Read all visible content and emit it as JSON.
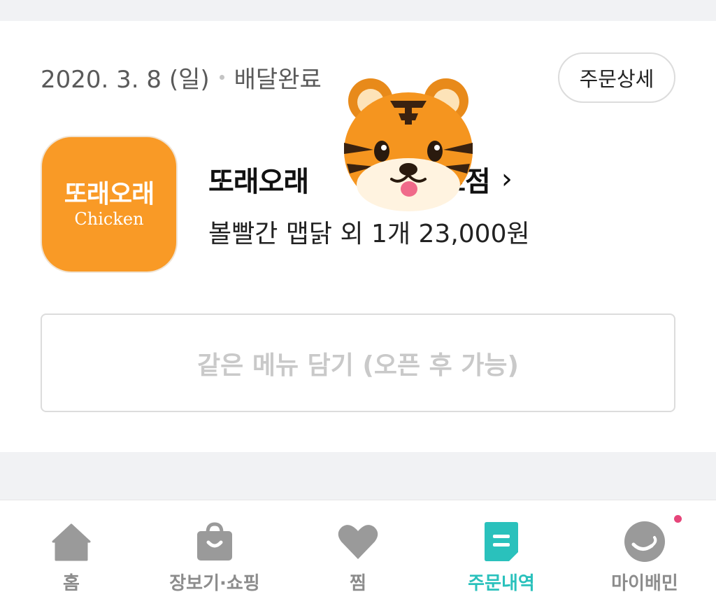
{
  "order": {
    "date": "2020. 3. 8 (일)",
    "status": "배달완료",
    "detail_button": "주문상세",
    "store": {
      "logo_text_ko": "또래오래",
      "logo_text_en": "Chicken",
      "name_start": "또래오래",
      "name_end": "트점",
      "chevron": "›"
    },
    "menu_summary": "볼빨간 맵닭 외 1개 23,000원",
    "reorder_button": "같은 메뉴 담기 (오픈 후 가능)"
  },
  "sticker": {
    "icon": "tiger-face-icon"
  },
  "tab_bar": {
    "active_color": "#2ac1bc",
    "tabs": [
      {
        "label": "홈",
        "icon": "home-icon"
      },
      {
        "label": "장보기·쇼핑",
        "icon": "shopping-bag-icon"
      },
      {
        "label": "찜",
        "icon": "heart-icon"
      },
      {
        "label": "주문내역",
        "icon": "order-list-icon"
      },
      {
        "label": "마이배민",
        "icon": "my-profile-icon"
      }
    ]
  }
}
